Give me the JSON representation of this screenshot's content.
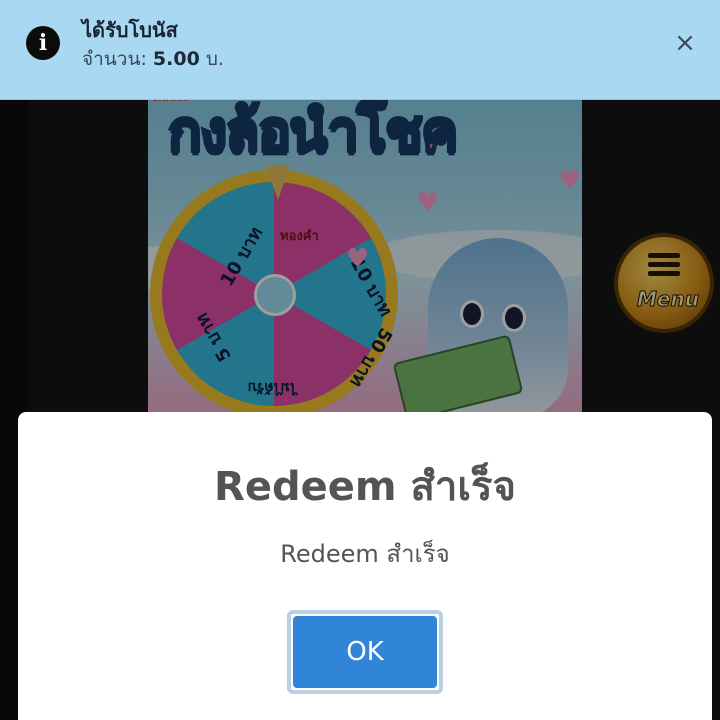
{
  "toast": {
    "icon": "info-icon",
    "icon_glyph": "i",
    "title": "ได้รับโบนัส",
    "amount_label": "จำนวน:",
    "amount_value": "5.00",
    "amount_unit": "บ.",
    "close_glyph": "×"
  },
  "banner": {
    "brand": "SHARK",
    "title": "กงล้อนำโชค",
    "wheel_segments": [
      "10 บาท",
      "ทองคำ",
      "10 บาท",
      "50 บาท",
      "ไม่ได้รับ",
      "5 บาท"
    ]
  },
  "menu_badge": {
    "label": "Menu"
  },
  "modal": {
    "title": "Redeem สำเร็จ",
    "message": "Redeem สำเร็จ",
    "ok_label": "OK"
  },
  "colors": {
    "toast_bg": "#a9d8f2",
    "ok_button": "#3085d6",
    "modal_text": "#545454",
    "wheel_rim": "#f4c531",
    "wheel_pink": "#e04fa9",
    "wheel_blue": "#39bde3"
  }
}
